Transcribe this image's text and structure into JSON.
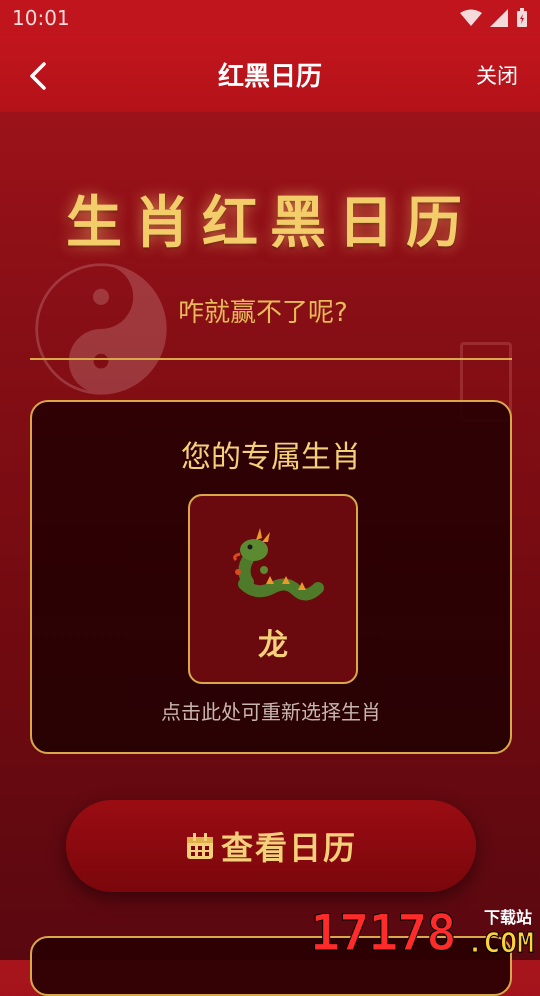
{
  "status": {
    "time": "10:01"
  },
  "header": {
    "title": "红黑日历",
    "close_label": "关闭"
  },
  "hero": {
    "title": "生肖红黑日历",
    "subtitle": "咋就赢不了呢?"
  },
  "card": {
    "title": "您的专属生肖",
    "zodiac_name": "龙",
    "zodiac_icon": "dragon-icon",
    "hint": "点击此处可重新选择生肖"
  },
  "action": {
    "label": "查看日历",
    "icon": "calendar-icon"
  },
  "watermark": {
    "number": "17178",
    "site": "下载站",
    "domain": ".COM"
  },
  "colors": {
    "primary_red": "#c0151d",
    "gold": "#f2cd6a",
    "dark_bg": "#280002"
  }
}
